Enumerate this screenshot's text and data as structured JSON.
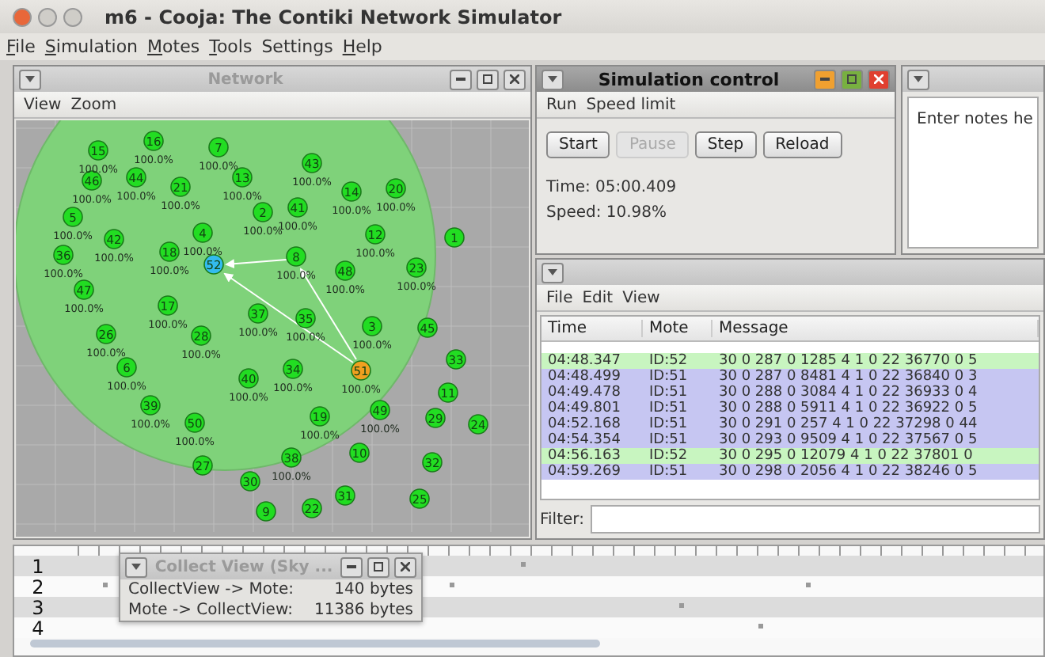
{
  "window": {
    "title": "m6 - Cooja: The Contiki Network Simulator"
  },
  "menu_bar": [
    {
      "label": "File",
      "mnemonic": true
    },
    {
      "label": "Simulation",
      "mnemonic": true
    },
    {
      "label": "Motes",
      "mnemonic": true
    },
    {
      "label": "Tools",
      "mnemonic": true
    },
    {
      "label": "Settings",
      "mnemonic": false
    },
    {
      "label": "Help",
      "mnemonic": true
    }
  ],
  "network": {
    "title": "Network",
    "active": false,
    "menu": [
      "View",
      "Zoom"
    ],
    "motes": [
      {
        "id": "15",
        "label": "100.0%",
        "color": "#22dd22"
      },
      {
        "id": "16",
        "label": "100.0%",
        "color": "#22dd22"
      },
      {
        "id": "7",
        "label": "100.0%",
        "color": "#22dd22"
      },
      {
        "id": "43",
        "label": "100.0%",
        "color": "#22dd22"
      },
      {
        "id": "46",
        "label": "100.0%",
        "color": "#22dd22"
      },
      {
        "id": "44",
        "label": "100.0%",
        "color": "#22dd22"
      },
      {
        "id": "21",
        "label": "100.0%",
        "color": "#22dd22"
      },
      {
        "id": "13",
        "label": "100.0%",
        "color": "#22dd22"
      },
      {
        "id": "14",
        "label": "100.0%",
        "color": "#22dd22"
      },
      {
        "id": "20",
        "label": "100.0%",
        "color": "#22dd22"
      },
      {
        "id": "5",
        "label": "100.0%",
        "color": "#22dd22"
      },
      {
        "id": "2",
        "label": "100.0%",
        "color": "#22dd22"
      },
      {
        "id": "41",
        "label": "100.0%",
        "color": "#22dd22"
      },
      {
        "id": "42",
        "label": "100.0%",
        "color": "#22dd22"
      },
      {
        "id": "4",
        "label": "100.0%",
        "color": "#22dd22"
      },
      {
        "id": "12",
        "label": "100.0%",
        "color": "#22dd22"
      },
      {
        "id": "1",
        "color": "#22dd22"
      },
      {
        "id": "36",
        "label": "100.0%",
        "color": "#22dd22"
      },
      {
        "id": "18",
        "label": "100.0%",
        "color": "#22dd22"
      },
      {
        "id": "52",
        "color": "#33bbee"
      },
      {
        "id": "8",
        "label": "100.0%",
        "color": "#22dd22"
      },
      {
        "id": "48",
        "label": "100.0%",
        "color": "#22dd22"
      },
      {
        "id": "23",
        "label": "100.0%",
        "color": "#22dd22"
      },
      {
        "id": "47",
        "label": "100.0%",
        "color": "#22dd22"
      },
      {
        "id": "17",
        "label": "100.0%",
        "color": "#22dd22"
      },
      {
        "id": "37",
        "label": "100.0%",
        "color": "#22dd22"
      },
      {
        "id": "35",
        "label": "100.0%",
        "color": "#22dd22"
      },
      {
        "id": "26",
        "label": "100.0%",
        "color": "#22dd22"
      },
      {
        "id": "28",
        "label": "100.0%",
        "color": "#22dd22"
      },
      {
        "id": "3",
        "label": "100.0%",
        "color": "#22dd22"
      },
      {
        "id": "45",
        "color": "#22dd22"
      },
      {
        "id": "6",
        "label": "100.0%",
        "color": "#22dd22"
      },
      {
        "id": "34",
        "label": "100.0%",
        "color": "#22dd22"
      },
      {
        "id": "51",
        "label": "100.0%",
        "color": "#f0a020"
      },
      {
        "id": "33",
        "color": "#22dd22"
      },
      {
        "id": "40",
        "label": "100.0%",
        "color": "#22dd22"
      },
      {
        "id": "11",
        "color": "#22dd22"
      },
      {
        "id": "39",
        "label": "100.0%",
        "color": "#22dd22"
      },
      {
        "id": "49",
        "label": "100.0%",
        "color": "#22dd22"
      },
      {
        "id": "50",
        "label": "100.0%",
        "color": "#22dd22"
      },
      {
        "id": "19",
        "label": "100.0%",
        "color": "#22dd22"
      },
      {
        "id": "29",
        "color": "#22dd22"
      },
      {
        "id": "24",
        "color": "#22dd22"
      },
      {
        "id": "27",
        "color": "#22dd22"
      },
      {
        "id": "38",
        "label": "100.0%",
        "color": "#22dd22"
      },
      {
        "id": "10",
        "color": "#22dd22"
      },
      {
        "id": "32",
        "color": "#22dd22"
      },
      {
        "id": "30",
        "color": "#22dd22"
      },
      {
        "id": "31",
        "color": "#22dd22"
      },
      {
        "id": "25",
        "color": "#22dd22"
      },
      {
        "id": "9",
        "color": "#22dd22"
      },
      {
        "id": "22",
        "color": "#22dd22"
      }
    ]
  },
  "sim_control": {
    "title": "Simulation control",
    "active": true,
    "menu": [
      "Run",
      "Speed limit"
    ],
    "buttons": [
      {
        "label": "Start",
        "disabled": false
      },
      {
        "label": "Pause",
        "disabled": true
      },
      {
        "label": "Step",
        "disabled": false
      },
      {
        "label": "Reload",
        "disabled": false
      }
    ],
    "time": "Time: 05:00.409",
    "speed": "Speed: 10.98%"
  },
  "notes": {
    "text": "Enter notes he"
  },
  "log": {
    "menu": [
      "File",
      "Edit",
      "View"
    ],
    "columns": [
      "Time",
      "Mote",
      "Message"
    ],
    "rows": [
      {
        "time": "04:48.347",
        "mote": "ID:52",
        "message": "30 0 287 0 1285 4 1 0 22 36770 0 5",
        "color": "#c8f5c0"
      },
      {
        "time": "04:48.499",
        "mote": "ID:51",
        "message": "30 0 287 0 8481 4 1 0 22 36840 0 3",
        "color": "#c6c6f2"
      },
      {
        "time": "04:49.478",
        "mote": "ID:51",
        "message": "30 0 288 0 3084 4 1 0 22 36933 0 4",
        "color": "#c6c6f2"
      },
      {
        "time": "04:49.801",
        "mote": "ID:51",
        "message": "30 0 288 0 5911 4 1 0 22 36922 0 5",
        "color": "#c6c6f2"
      },
      {
        "time": "04:52.168",
        "mote": "ID:51",
        "message": "30 0 291 0 257 4 1 0 22 37298 0 44",
        "color": "#c6c6f2"
      },
      {
        "time": "04:54.354",
        "mote": "ID:51",
        "message": "30 0 293 0 9509 4 1 0 22 37567 0 5",
        "color": "#c6c6f2"
      },
      {
        "time": "04:56.163",
        "mote": "ID:52",
        "message": "30 0 295 0 12079 4 1 0 22 37801 0",
        "color": "#c8f5c0"
      },
      {
        "time": "04:59.269",
        "mote": "ID:51",
        "message": "30 0 298 0 2056 4 1 0 22 38246 0 5",
        "color": "#c6c6f2"
      }
    ],
    "filter_label": "Filter:"
  },
  "timeline": {
    "rows": [
      "1",
      "2",
      "3",
      "4"
    ]
  },
  "collect_view": {
    "title": "Collect View (Sky ...",
    "active": false,
    "rows": [
      {
        "label": "CollectView -> Mote:",
        "value": "140 bytes"
      },
      {
        "label": "Mote -> CollectView:",
        "value": "11386 bytes"
      }
    ]
  }
}
